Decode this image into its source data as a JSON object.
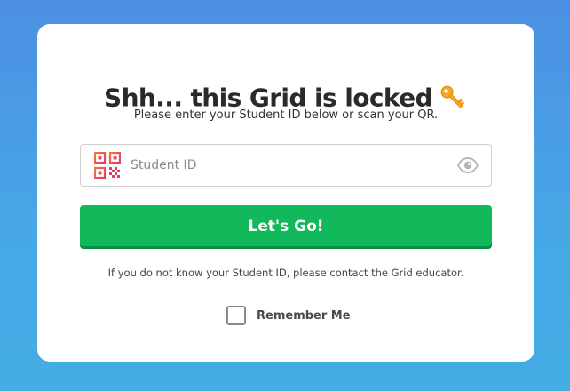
{
  "card": {
    "title": "Shh... this Grid is locked",
    "title_icon": "key-icon",
    "subtitle": "Please enter your Student ID below or scan your QR.",
    "student_id_input": {
      "value": "",
      "placeholder": "Student ID",
      "left_icon": "qr-code-icon",
      "right_icon": "eye-icon"
    },
    "submit_label": "Let's Go!",
    "help_text": "If you do not know your Student ID, please contact the Grid educator.",
    "remember": {
      "label": "Remember Me",
      "checked": false
    }
  },
  "colors": {
    "background_top": "#4c8fe3",
    "background_bottom": "#43ade4",
    "button_green": "#11b95a",
    "key_gold": "#f5a623"
  }
}
